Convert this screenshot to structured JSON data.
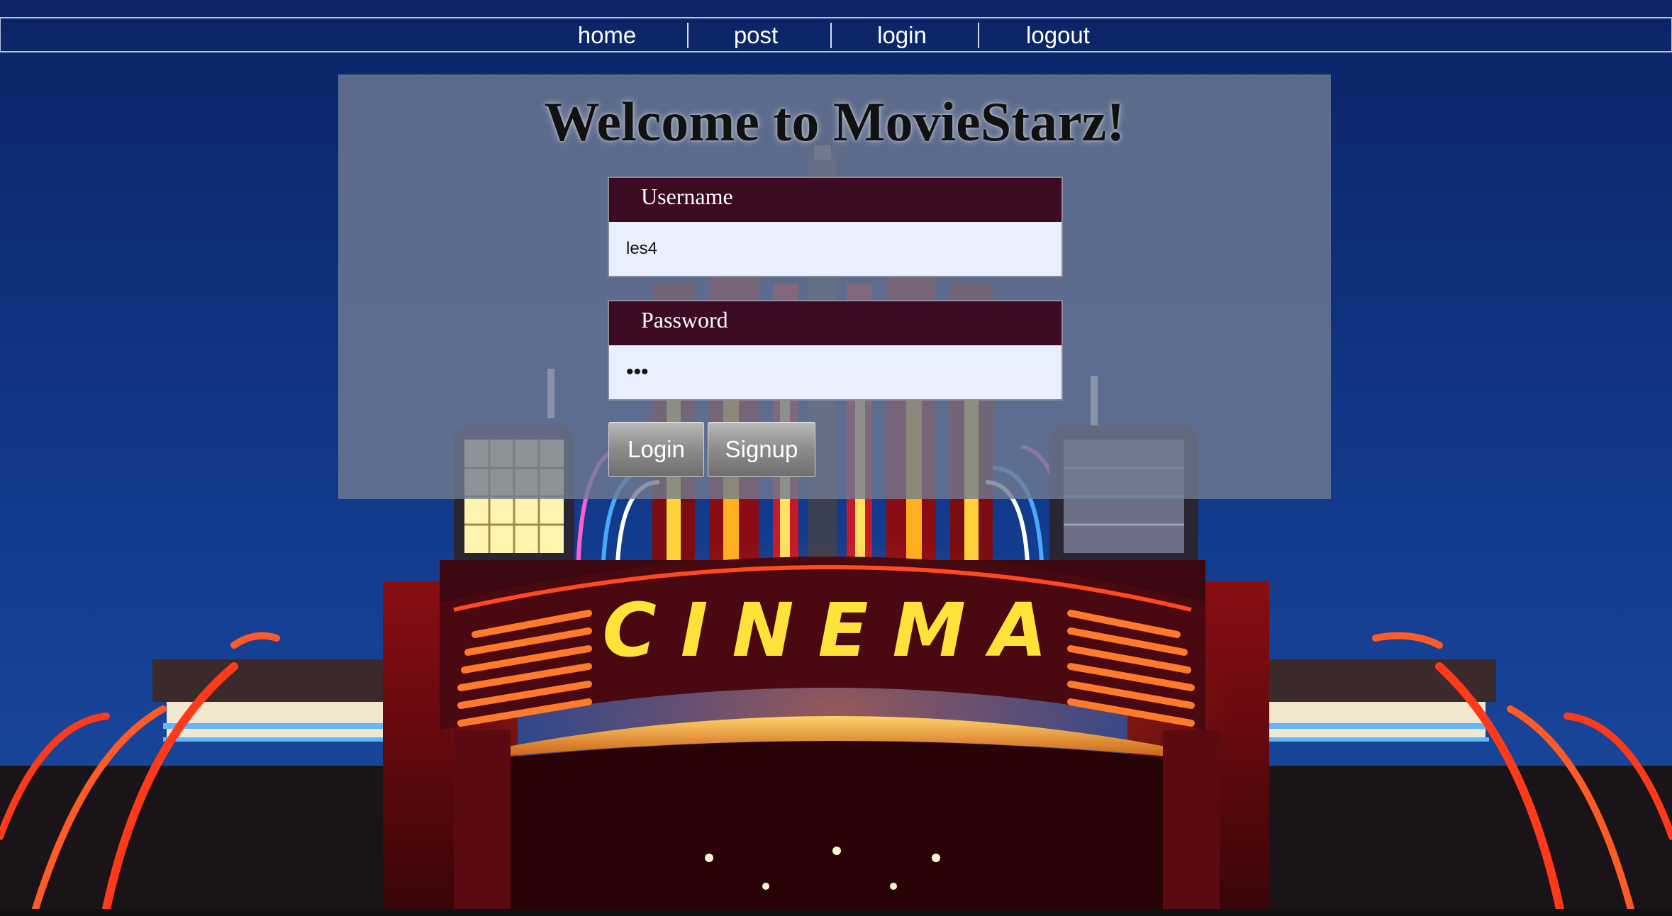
{
  "nav": {
    "items": [
      {
        "label": "home"
      },
      {
        "label": "post"
      },
      {
        "label": "login"
      },
      {
        "label": "logout"
      }
    ]
  },
  "page": {
    "title": "Welcome to MovieStarz!"
  },
  "form": {
    "username": {
      "label": "Username",
      "value": "les4"
    },
    "password": {
      "label": "Password",
      "value": "les"
    },
    "buttons": {
      "login": "Login",
      "signup": "Signup"
    }
  },
  "background": {
    "marquee_text": "CINEMA"
  },
  "colors": {
    "sky": "#0c2a6e",
    "field_label_bg": "#3d0a24",
    "field_bg": "#e9effc",
    "marquee_text": "#ffe23a"
  }
}
